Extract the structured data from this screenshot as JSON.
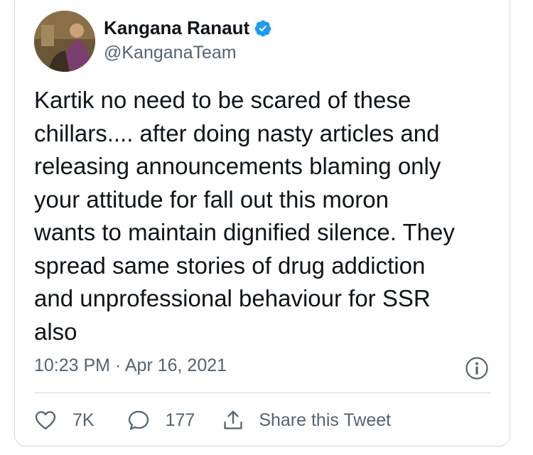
{
  "author": {
    "name": "Kangana Ranaut",
    "handle": "@KanganaTeam",
    "verified_icon": "verified-badge-icon"
  },
  "tweet": {
    "text": "Kartik no need to be scared of these\nchillars.... after doing nasty articles and\nreleasing announcements blaming only\nyour attitude for fall out this moron\nwants to maintain dignified silence. They\nspread same stories of drug addiction\nand unprofessional behaviour for SSR\nalso",
    "time": "10:23 PM",
    "separator": "·",
    "date": "Apr 16, 2021"
  },
  "actions": {
    "like_count": "7K",
    "reply_count": "177",
    "share_label": "Share this Tweet"
  },
  "colors": {
    "text": "#0f1419",
    "secondary": "#536471",
    "verified": "#1d9bf0",
    "border": "#cfd9de"
  }
}
